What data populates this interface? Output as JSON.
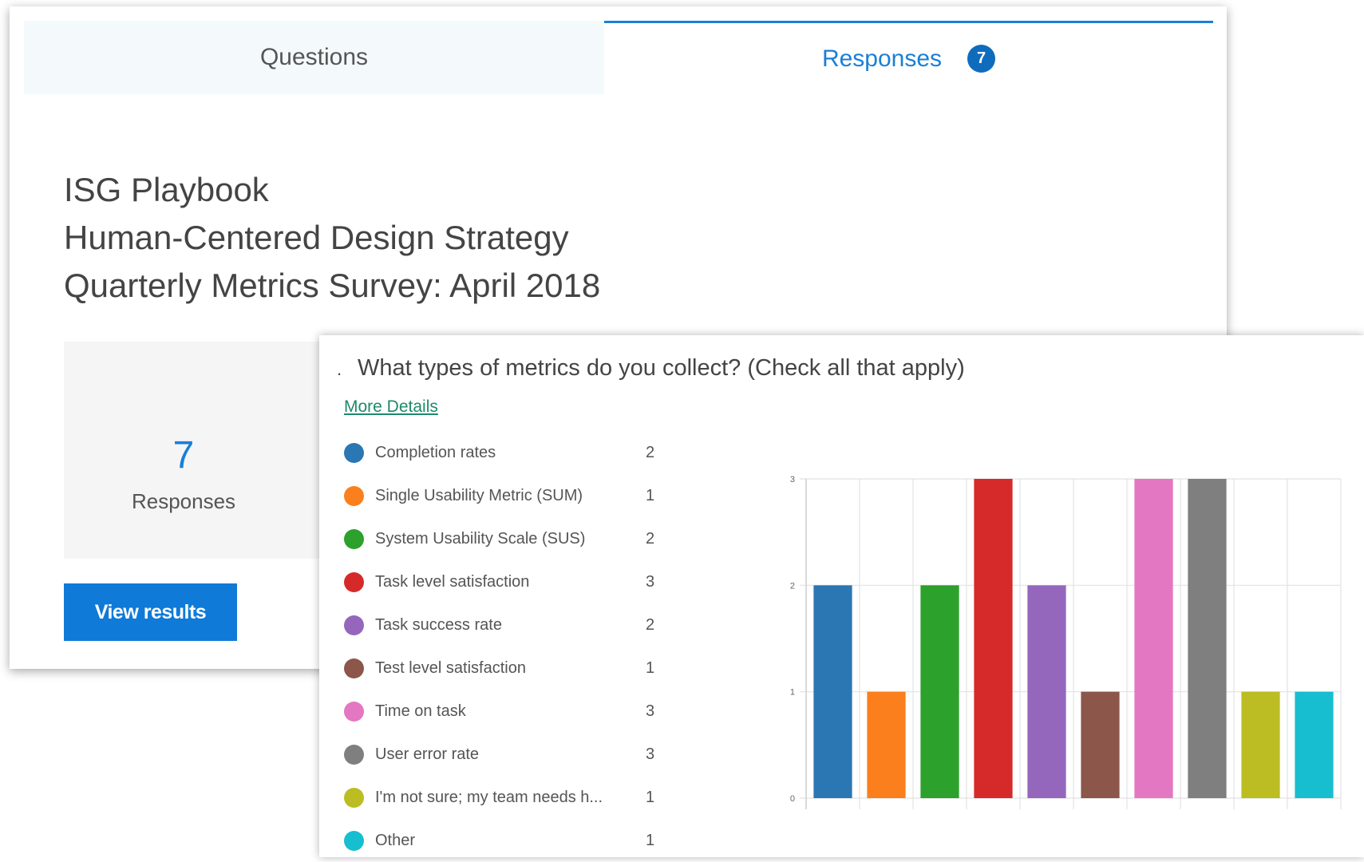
{
  "tabs": {
    "questions_label": "Questions",
    "responses_label": "Responses",
    "responses_badge": "7"
  },
  "survey": {
    "title_line1": "ISG Playbook",
    "title_line2": "Human-Centered Design Strategy",
    "title_line3": "Quarterly Metrics Survey: April 2018"
  },
  "summary": {
    "count": "7",
    "label": "Responses",
    "view_results_label": "View results"
  },
  "question": {
    "number_mark": ".",
    "title": "What types of metrics do you collect? (Check all that apply)",
    "more_details_label": "More Details",
    "options": [
      {
        "label": "Completion rates",
        "count": "2",
        "color": "#2b77b4"
      },
      {
        "label": "Single Usability Metric (SUM)",
        "count": "1",
        "color": "#fb7f1c"
      },
      {
        "label": "System Usability Scale (SUS)",
        "count": "2",
        "color": "#2ca12c"
      },
      {
        "label": "Task level satisfaction",
        "count": "3",
        "color": "#d62a2a"
      },
      {
        "label": "Task success rate",
        "count": "2",
        "color": "#9467bd"
      },
      {
        "label": "Test level satisfaction",
        "count": "1",
        "color": "#8c564b"
      },
      {
        "label": "Time on task",
        "count": "3",
        "color": "#e377c2"
      },
      {
        "label": "User error rate",
        "count": "3",
        "color": "#7f7f7f"
      },
      {
        "label": "I'm not sure; my team needs h...",
        "count": "1",
        "color": "#bcbd22"
      },
      {
        "label": "Other",
        "count": "1",
        "color": "#17becf"
      }
    ]
  },
  "chart_data": {
    "type": "bar",
    "categories": [
      "Completion rates",
      "Single Usability Metric (SUM)",
      "System Usability Scale (SUS)",
      "Task level satisfaction",
      "Task success rate",
      "Test level satisfaction",
      "Time on task",
      "User error rate",
      "I'm not sure; my team needs h...",
      "Other"
    ],
    "values": [
      2,
      1,
      2,
      3,
      2,
      1,
      3,
      3,
      1,
      1
    ],
    "colors": [
      "#2b77b4",
      "#fb7f1c",
      "#2ca12c",
      "#d62a2a",
      "#9467bd",
      "#8c564b",
      "#e377c2",
      "#7f7f7f",
      "#bcbd22",
      "#17becf"
    ],
    "yticks": [
      "0",
      "1",
      "2",
      "3"
    ],
    "ylim": [
      0,
      3
    ],
    "grid": true,
    "title": "",
    "xlabel": "",
    "ylabel": ""
  }
}
